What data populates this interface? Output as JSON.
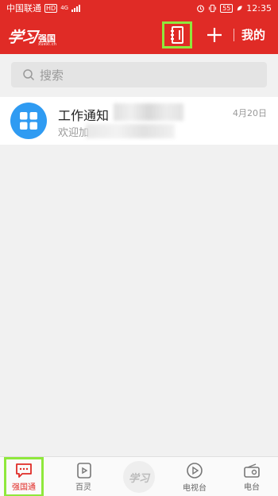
{
  "status_bar": {
    "carrier": "中国联通",
    "hd": "HD",
    "network": "4G",
    "battery": "55",
    "time": "12:35"
  },
  "header": {
    "logo_script": "学习",
    "logo_cn": "强国",
    "logo_en": "xuexi.cn",
    "contacts_icon": "address-book-icon",
    "add_icon": "plus-icon",
    "mine_label": "我的",
    "highlight_color": "#8fe83c",
    "brand_color": "#e02b26"
  },
  "search": {
    "placeholder": "搜索",
    "icon": "search-icon"
  },
  "conversations": [
    {
      "title": "工作通知",
      "preview": "欢迎加",
      "date": "4月20日",
      "avatar_icon": "grid-apps-icon",
      "avatar_color": "#2f9bf2"
    }
  ],
  "bottom_nav": {
    "items": [
      {
        "label": "强国通",
        "icon": "chat-bubble-icon",
        "active": true
      },
      {
        "label": "百灵",
        "icon": "play-card-icon",
        "active": false
      },
      {
        "label": "学习",
        "icon": "xuexi-logo-icon",
        "active": false
      },
      {
        "label": "电视台",
        "icon": "play-circle-icon",
        "active": false
      },
      {
        "label": "电台",
        "icon": "radio-icon",
        "active": false
      }
    ]
  }
}
